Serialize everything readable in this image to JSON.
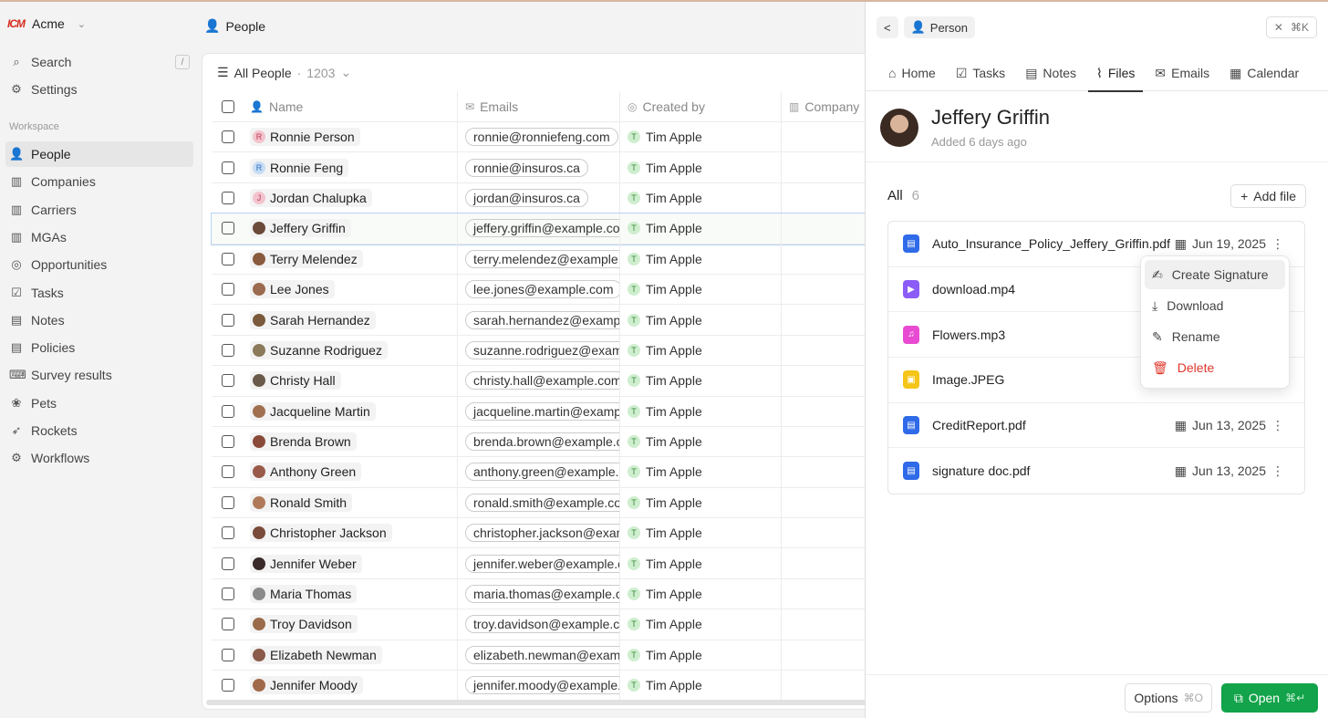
{
  "workspace": {
    "logo": "ICM",
    "name": "Acme"
  },
  "sidebar": {
    "search": {
      "label": "Search",
      "shortcut": "/"
    },
    "settings": {
      "label": "Settings"
    },
    "section": "Workspace",
    "items": [
      {
        "label": "People",
        "icon": "user-icon",
        "active": true
      },
      {
        "label": "Companies",
        "icon": "building-icon"
      },
      {
        "label": "Carriers",
        "icon": "building-icon"
      },
      {
        "label": "MGAs",
        "icon": "building-icon"
      },
      {
        "label": "Opportunities",
        "icon": "target-icon"
      },
      {
        "label": "Tasks",
        "icon": "checkbox-icon"
      },
      {
        "label": "Notes",
        "icon": "note-icon"
      },
      {
        "label": "Policies",
        "icon": "document-icon"
      },
      {
        "label": "Survey results",
        "icon": "keyboard-icon"
      },
      {
        "label": "Pets",
        "icon": "paw-icon"
      },
      {
        "label": "Rockets",
        "icon": "rocket-icon"
      },
      {
        "label": "Workflows",
        "icon": "gear-icon"
      }
    ]
  },
  "main": {
    "title": "People",
    "view": {
      "label": "All People",
      "count": "1203"
    },
    "columns": {
      "name": "Name",
      "emails": "Emails",
      "created_by": "Created by",
      "company": "Company"
    },
    "rows": [
      {
        "name": "Ronnie Person",
        "email": "ronnie@ronniefeng.com",
        "created_by": "Tim Apple",
        "avatar": "R",
        "avatar_color": "#f3c4cd",
        "text_color": "#c03a55"
      },
      {
        "name": "Ronnie Feng",
        "email": "ronnie@insuros.ca",
        "created_by": "Tim Apple",
        "avatar": "R",
        "avatar_color": "#c7dcf5",
        "text_color": "#2d6fbf"
      },
      {
        "name": "Jordan Chalupka",
        "email": "jordan@insuros.ca",
        "created_by": "Tim Apple",
        "avatar": "J",
        "avatar_color": "#f3c4cd",
        "text_color": "#c03a55"
      },
      {
        "name": "Jeffery Griffin",
        "email": "jeffery.griffin@example.com",
        "created_by": "Tim Apple",
        "avatar": "",
        "avatar_color": "#6b4a3a",
        "selected": true
      },
      {
        "name": "Terry Melendez",
        "email": "terry.melendez@example.com",
        "created_by": "Tim Apple",
        "avatar": "",
        "avatar_color": "#8a5a3e"
      },
      {
        "name": "Lee Jones",
        "email": "lee.jones@example.com",
        "created_by": "Tim Apple",
        "avatar": "",
        "avatar_color": "#9c6a4e"
      },
      {
        "name": "Sarah Hernandez",
        "email": "sarah.hernandez@example.com",
        "created_by": "Tim Apple",
        "avatar": "",
        "avatar_color": "#7a5a3a"
      },
      {
        "name": "Suzanne Rodriguez",
        "email": "suzanne.rodriguez@example.com",
        "created_by": "Tim Apple",
        "avatar": "",
        "avatar_color": "#8a7a5a"
      },
      {
        "name": "Christy Hall",
        "email": "christy.hall@example.com",
        "created_by": "Tim Apple",
        "avatar": "",
        "avatar_color": "#6a5a4a"
      },
      {
        "name": "Jacqueline Martin",
        "email": "jacqueline.martin@example.com",
        "created_by": "Tim Apple",
        "avatar": "",
        "avatar_color": "#a07050"
      },
      {
        "name": "Brenda Brown",
        "email": "brenda.brown@example.com",
        "created_by": "Tim Apple",
        "avatar": "",
        "avatar_color": "#8a4a3a"
      },
      {
        "name": "Anthony Green",
        "email": "anthony.green@example.com",
        "created_by": "Tim Apple",
        "avatar": "",
        "avatar_color": "#9a5a4a"
      },
      {
        "name": "Ronald Smith",
        "email": "ronald.smith@example.com",
        "created_by": "Tim Apple",
        "avatar": "",
        "avatar_color": "#b07a5a"
      },
      {
        "name": "Christopher Jackson",
        "email": "christopher.jackson@example.com",
        "created_by": "Tim Apple",
        "avatar": "",
        "avatar_color": "#7a4a3a"
      },
      {
        "name": "Jennifer Weber",
        "email": "jennifer.weber@example.com",
        "created_by": "Tim Apple",
        "avatar": "",
        "avatar_color": "#3a2a2a"
      },
      {
        "name": "Maria Thomas",
        "email": "maria.thomas@example.com",
        "created_by": "Tim Apple",
        "avatar": "",
        "avatar_color": "#8a8a8a"
      },
      {
        "name": "Troy Davidson",
        "email": "troy.davidson@example.com",
        "created_by": "Tim Apple",
        "avatar": "",
        "avatar_color": "#9a6a4a"
      },
      {
        "name": "Elizabeth Newman",
        "email": "elizabeth.newman@example.com",
        "created_by": "Tim Apple",
        "avatar": "",
        "avatar_color": "#8a5a4a"
      },
      {
        "name": "Jennifer Moody",
        "email": "jennifer.moody@example.com",
        "created_by": "Tim Apple",
        "avatar": "",
        "avatar_color": "#a06a4a"
      }
    ],
    "creator_avatar": "T"
  },
  "panel": {
    "back_label": "<",
    "type_label": "Person",
    "close_shortcut": "⌘K",
    "tabs": [
      {
        "label": "Home",
        "icon": "home-icon"
      },
      {
        "label": "Tasks",
        "icon": "checkbox-icon"
      },
      {
        "label": "Notes",
        "icon": "note-icon"
      },
      {
        "label": "Files",
        "icon": "paperclip-icon",
        "active": true
      },
      {
        "label": "Emails",
        "icon": "mail-icon"
      },
      {
        "label": "Calendar",
        "icon": "calendar-icon"
      }
    ],
    "person": {
      "name": "Jeffery Griffin",
      "added": "Added 6 days ago"
    },
    "files_header": {
      "label": "All",
      "count": "6",
      "add_label": "Add file"
    },
    "files": [
      {
        "name": "Auto_Insurance_Policy_Jeffery_Griffin.pdf",
        "date": "Jun 19, 2025",
        "kind": "pdf",
        "color": "#2f6ae8"
      },
      {
        "name": "download.mp4",
        "date": "",
        "kind": "video",
        "color": "#8b5cf6"
      },
      {
        "name": "Flowers.mp3",
        "date": "",
        "kind": "audio",
        "color": "#e84bd1"
      },
      {
        "name": "Image.JPEG",
        "date": "",
        "kind": "image",
        "color": "#f5c518"
      },
      {
        "name": "CreditReport.pdf",
        "date": "Jun 13, 2025",
        "kind": "pdf",
        "color": "#2f6ae8"
      },
      {
        "name": "signature doc.pdf",
        "date": "Jun 13, 2025",
        "kind": "pdf",
        "color": "#2f6ae8"
      }
    ],
    "menu": [
      {
        "label": "Create Signature",
        "icon": "signature-icon"
      },
      {
        "label": "Download",
        "icon": "download-icon"
      },
      {
        "label": "Rename",
        "icon": "pencil-icon"
      },
      {
        "label": "Delete",
        "icon": "trash-icon",
        "danger": true
      }
    ],
    "footer": {
      "options_label": "Options",
      "options_shortcut": "⌘O",
      "open_label": "Open",
      "open_shortcut": "⌘↵"
    }
  }
}
